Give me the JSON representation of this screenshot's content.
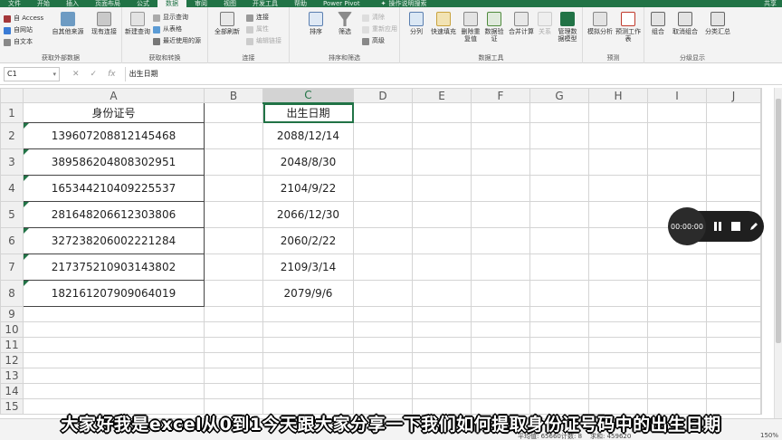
{
  "colors": {
    "accent": "#217346",
    "recorder": "#1f1f1f"
  },
  "tabs": [
    "文件",
    "开始",
    "插入",
    "页面布局",
    "公式",
    "数据",
    "审阅",
    "视图",
    "开发工具",
    "帮助",
    "Power Pivot"
  ],
  "active_tab": "数据",
  "tell_me": "操作说明搜索",
  "share": "共享",
  "ribbon": {
    "get_external": {
      "label": "获取外部数据",
      "access": "自 Access",
      "web": "自网站",
      "text": "自文本",
      "other": "自其他来源",
      "existing": "现有连接"
    },
    "transform": {
      "label": "获取和转换",
      "new_query": "新建查询",
      "show_queries": "显示查询",
      "from_table": "从表格",
      "recent": "最近使用的源"
    },
    "connections": {
      "label": "连接",
      "refresh_all": "全部刷新",
      "connections": "连接",
      "properties": "属性",
      "edit_links": "编辑链接"
    },
    "sort_filter": {
      "label": "排序和筛选",
      "sort": "排序",
      "filter": "筛选",
      "clear": "清除",
      "reapply": "重新应用",
      "advanced": "高级"
    },
    "data_tools": {
      "label": "数据工具",
      "split": "分列",
      "flash_fill": "快速填充",
      "remove_dup": "删除重复值",
      "validation": "数据验证",
      "consolidate": "合并计算",
      "relations": "关系",
      "data_model": "管理数据模型"
    },
    "forecast": {
      "label": "预测",
      "what_if": "模拟分析",
      "forecast_sheet": "预测工作表"
    },
    "outline": {
      "label": "分级显示",
      "group": "组合",
      "ungroup": "取消组合",
      "subtotal": "分类汇总"
    }
  },
  "name_box": "C1",
  "formula": "出生日期",
  "columns": [
    "A",
    "B",
    "C",
    "D",
    "E",
    "F",
    "G",
    "H",
    "I",
    "J"
  ],
  "rows": [
    "1",
    "2",
    "3",
    "4",
    "5",
    "6",
    "7",
    "8",
    "9",
    "10",
    "11",
    "12",
    "13",
    "14",
    "15"
  ],
  "headers": {
    "a": "身份证号",
    "c": "出生日期"
  },
  "records": [
    {
      "id": "139607208812145468",
      "date": "2088/12/14"
    },
    {
      "id": "389586204808302951",
      "date": "2048/8/30"
    },
    {
      "id": "165344210409225537",
      "date": "2104/9/22"
    },
    {
      "id": "281648206612303806",
      "date": "2066/12/30"
    },
    {
      "id": "327238206002221284",
      "date": "2060/2/22"
    },
    {
      "id": "217375210903143802",
      "date": "2109/3/14"
    },
    {
      "id": "182161207909064019",
      "date": "2079/9/6"
    }
  ],
  "status": {
    "average": "平均值: 65660",
    "count": "计数: 8",
    "sum": "求和: 459620",
    "zoom": "150%"
  },
  "recorder": {
    "time": "00:00:00"
  },
  "subtitle": "大家好我是excel从0到1今天跟大家分享一下我们如何提取身份证号码中的出生日期"
}
